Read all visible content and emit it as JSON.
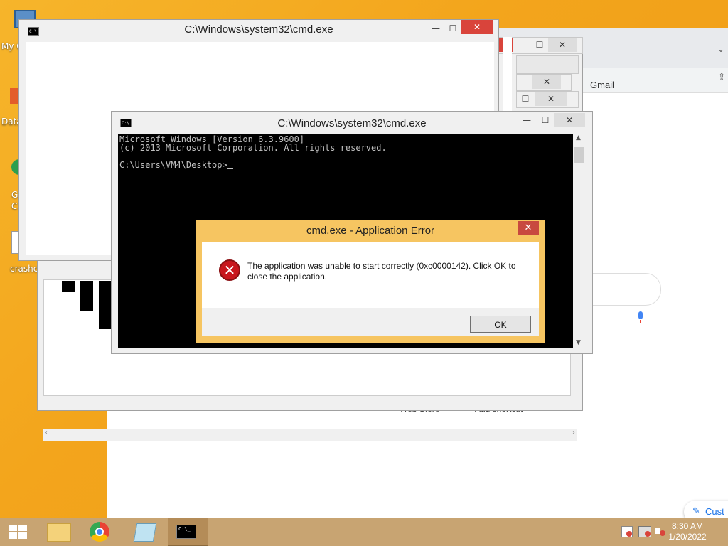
{
  "desktop": {
    "icons": [
      {
        "label": "My C"
      },
      {
        "label": "Data"
      },
      {
        "label": "G\nC"
      },
      {
        "label": "crashc"
      }
    ]
  },
  "chrome": {
    "gmail_label": "Gmail",
    "shortcuts": [
      "Web Store",
      "Add shortcut"
    ],
    "customize_label": "Cust"
  },
  "cmd_back": {
    "title": "C:\\Windows\\system32\\cmd.exe"
  },
  "cmd_front": {
    "title": "C:\\Windows\\system32\\cmd.exe",
    "line1": "Microsoft Windows [Version 6.3.9600]",
    "line2": "(c) 2013 Microsoft Corporation. All rights reserved.",
    "prompt": "C:\\Users\\VM4\\Desktop>"
  },
  "error_dialog": {
    "title": "cmd.exe - Application Error",
    "message": "The application was unable to start correctly (0xc0000142). Click OK to close the application.",
    "ok_label": "OK",
    "close_glyph": "✕"
  },
  "window_controls": {
    "minimize": "—",
    "maximize": "☐",
    "close": "✕"
  },
  "taskbar": {
    "items": [
      "start-button",
      "file-explorer",
      "google-chrome",
      "notepad",
      "command-prompt"
    ],
    "time": "8:30 AM",
    "date": "1/20/2022"
  },
  "colors": {
    "desktop": "#f3a51c",
    "close_red": "#d9443b",
    "dialog_frame": "#f6c561",
    "taskbar": "#c8a472"
  }
}
